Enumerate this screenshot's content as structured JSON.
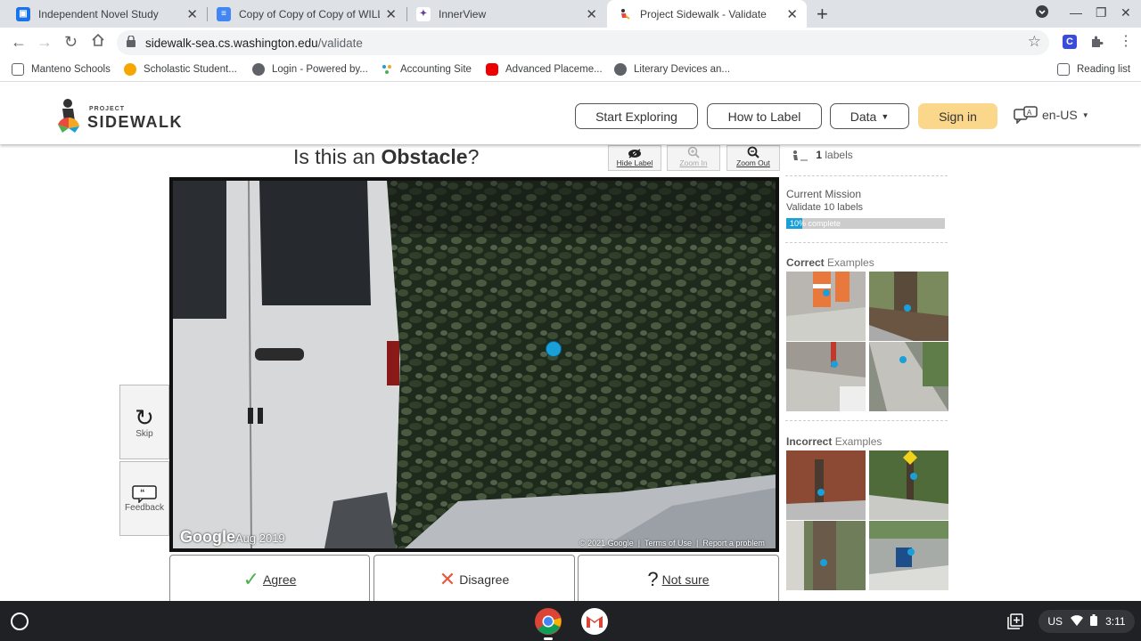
{
  "browser": {
    "tabs": [
      {
        "title": "Independent Novel Study",
        "active": false
      },
      {
        "title": "Copy of Copy of Copy of WILLIA",
        "active": false
      },
      {
        "title": "InnerView",
        "active": false
      },
      {
        "title": "Project Sidewalk - Validate",
        "active": true
      }
    ],
    "url_host": "sidewalk-sea.cs.washington.edu",
    "url_path": "/validate",
    "bookmarks": [
      "Manteno Schools",
      "Scholastic Student...",
      "Login - Powered by...",
      "Accounting Site",
      "Advanced Placeme...",
      "Literary Devices an..."
    ],
    "reading_list": "Reading list"
  },
  "site": {
    "logo_top": "PROJECT",
    "logo_main": "SIDEWALK",
    "nav": {
      "start_exploring": "Start Exploring",
      "how_to_label": "How to Label",
      "data": "Data",
      "sign_in": "Sign in"
    },
    "language": "en-US"
  },
  "validate": {
    "question_prefix": "Is this an ",
    "question_label": "Obstacle",
    "question_suffix": "?",
    "tools": {
      "hide_label": "Hide Label",
      "zoom_in": "Zoom In",
      "zoom_out": "Zoom Out"
    },
    "pano": {
      "google": "Google",
      "date": "Aug 2019",
      "copyright": "© 2021 Google",
      "terms": "Terms of Use",
      "report": "Report a problem"
    },
    "skip": "Skip",
    "feedback": "Feedback",
    "agree": "Agree",
    "disagree": "Disagree",
    "not_sure": "Not sure"
  },
  "panel": {
    "label_count": "1",
    "label_count_suffix": "labels",
    "mission_title": "Current Mission",
    "mission_sub": "Validate 10 labels",
    "progress_text": "10% complete",
    "progress": 0.1,
    "correct_word": "Correct",
    "incorrect_word": "Incorrect",
    "examples_word": "Examples"
  },
  "shelf": {
    "ime": "US",
    "time": "3:11"
  },
  "colors": {
    "accent": "#1aa0d8",
    "sign_in": "#fbd78b"
  }
}
